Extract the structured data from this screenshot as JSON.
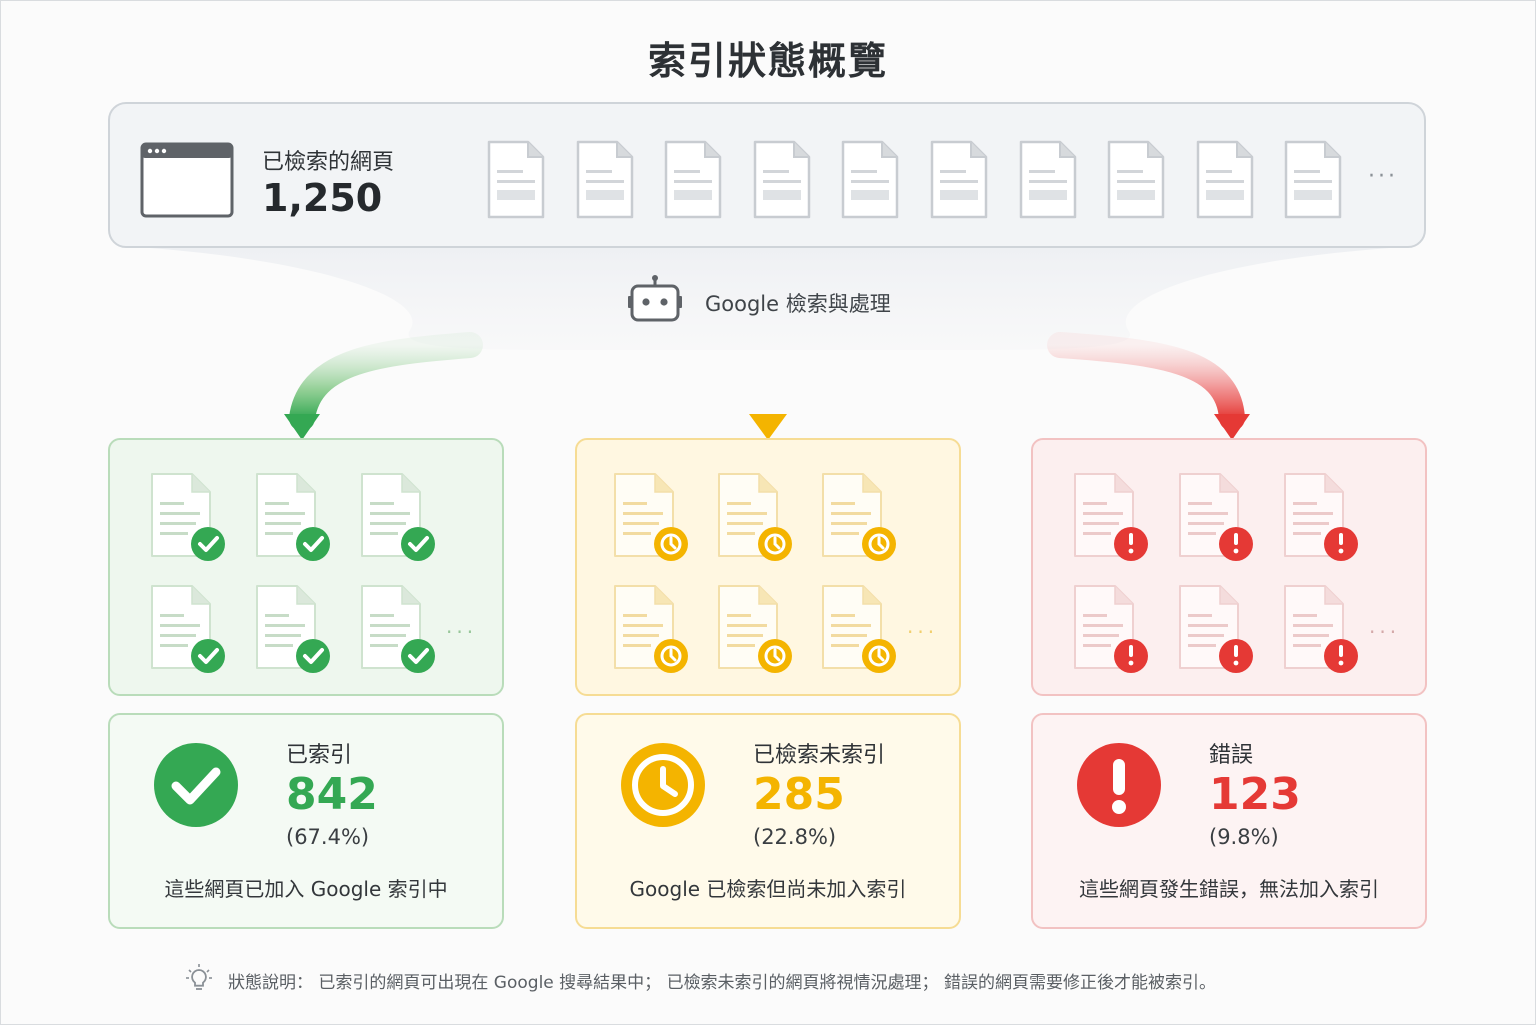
{
  "title": "索引狀態概覽",
  "source": {
    "label": "已檢索的網頁",
    "count": "1,250",
    "ellipsis": "···"
  },
  "process": {
    "label": "Google 檢索與處理"
  },
  "categories": [
    {
      "key": "indexed",
      "label": "已索引",
      "count": "842",
      "percent": "(67.4%)",
      "description": "這些網頁已加入 Google 索引中",
      "ellipsis": "···",
      "badge_icon": "check-icon",
      "color": "#34a853"
    },
    {
      "key": "crawled",
      "label": "已檢索未索引",
      "count": "285",
      "percent": "(22.8%)",
      "description": "Google 已檢索但尚未加入索引",
      "ellipsis": "···",
      "badge_icon": "clock-icon",
      "color": "#f4b400"
    },
    {
      "key": "error",
      "label": "錯誤",
      "count": "123",
      "percent": "(9.8%)",
      "description": "這些網頁發生錯誤，無法加入索引",
      "ellipsis": "···",
      "badge_icon": "exclamation-icon",
      "color": "#e53935"
    }
  ],
  "footnote": {
    "text": "狀態說明： 已索引的網頁可出現在 Google 搜尋結果中； 已檢索未索引的網頁將視情況處理； 錯誤的網頁需要修正後才能被索引。",
    "icon": "lightbulb-icon"
  }
}
